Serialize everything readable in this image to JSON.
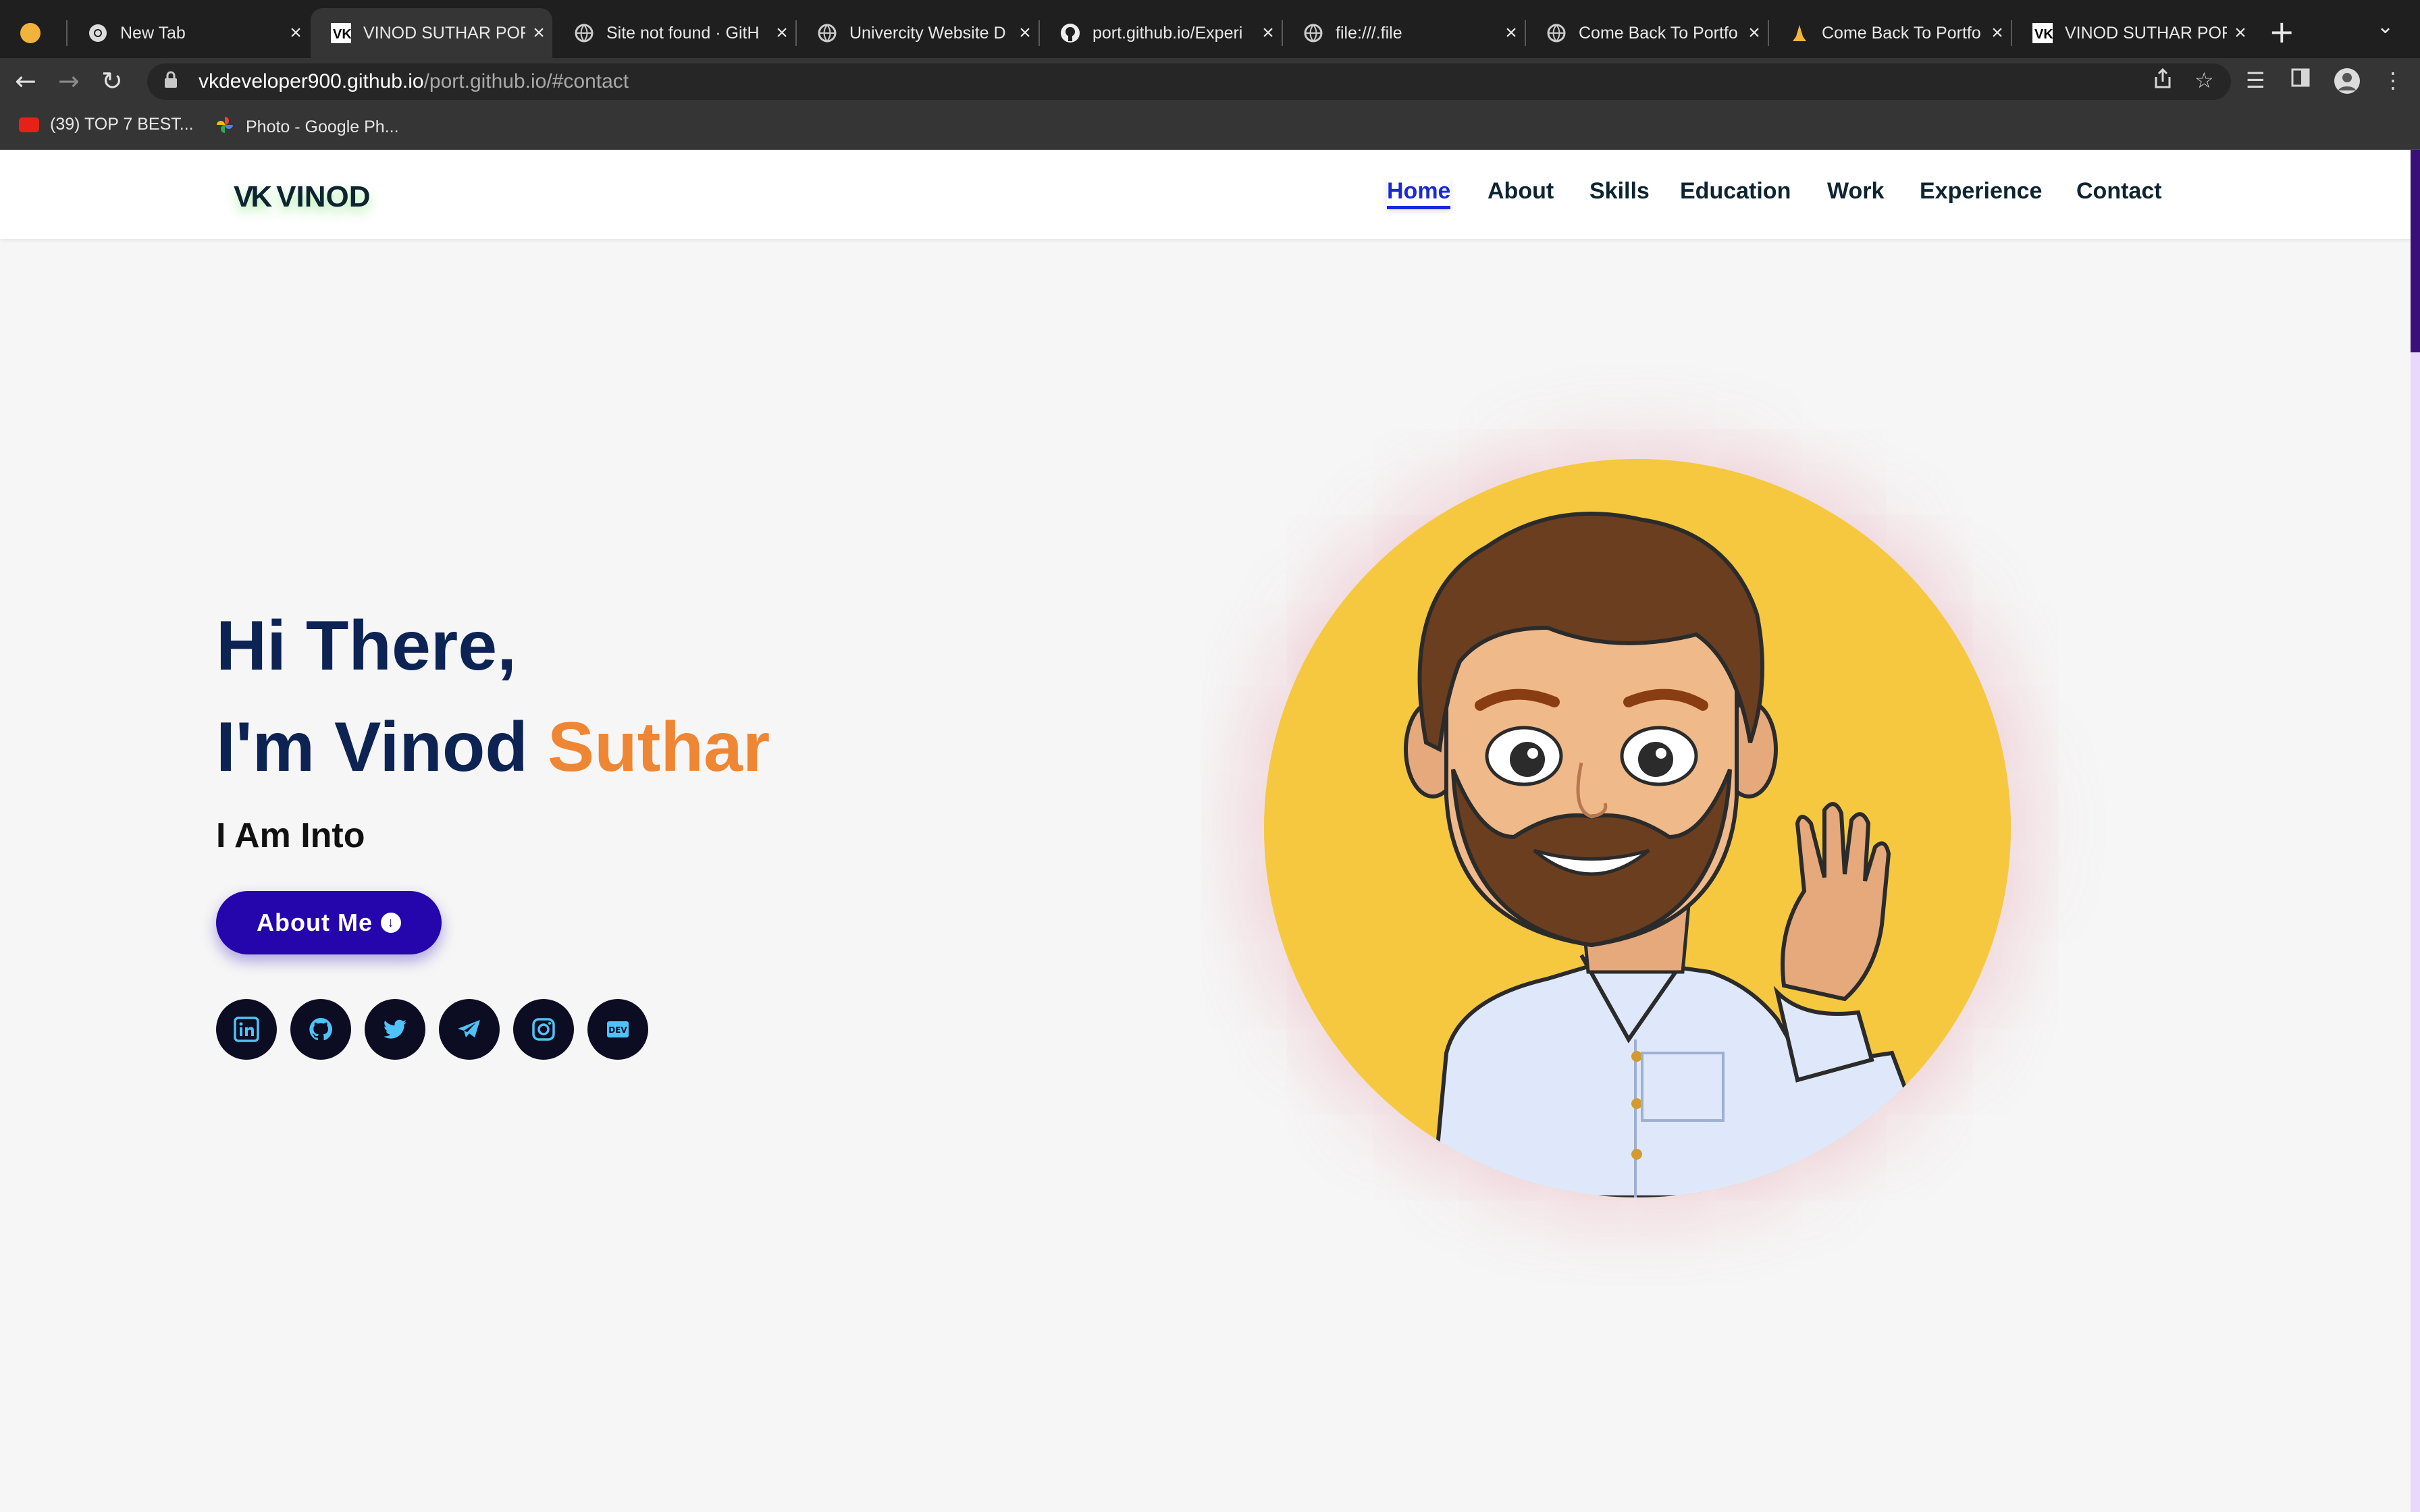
{
  "browser": {
    "tabs": [
      {
        "title": "",
        "icon": "profile-avatar-icon",
        "active": false
      },
      {
        "title": "New Tab",
        "icon": "chrome-icon",
        "active": false
      },
      {
        "title": "VINOD SUTHAR POR",
        "icon": "vk-logo-icon",
        "active": true
      },
      {
        "title": "Site not found · GitH",
        "icon": "globe-icon",
        "active": false
      },
      {
        "title": "Univercity Website D",
        "icon": "globe-icon",
        "active": false
      },
      {
        "title": "port.github.io/Experi",
        "icon": "github-icon",
        "active": false
      },
      {
        "title": "file:///.file",
        "icon": "globe-icon",
        "active": false
      },
      {
        "title": "Come Back To Portfo",
        "icon": "globe-icon",
        "active": false
      },
      {
        "title": "Come Back To Portfo",
        "icon": "praying-hands-icon",
        "active": false
      },
      {
        "title": "VINOD SUTHAR POR",
        "icon": "vk-logo-icon",
        "active": false
      }
    ],
    "url_host": "vkdeveloper900.github.io",
    "url_path": "/port.github.io/#contact",
    "bookmarks": [
      {
        "label": "(39) TOP 7 BEST...",
        "icon": "youtube-icon"
      },
      {
        "label": "Photo - Google Ph...",
        "icon": "google-photos-icon"
      }
    ]
  },
  "site": {
    "logo_mark": "VK",
    "logo_text": "VINOD",
    "nav": [
      {
        "label": "Home",
        "active": true
      },
      {
        "label": "About",
        "active": false
      },
      {
        "label": "Skills",
        "active": false
      },
      {
        "label": "Education",
        "active": false
      },
      {
        "label": "Work",
        "active": false
      },
      {
        "label": "Experience",
        "active": false
      },
      {
        "label": "Contact",
        "active": false
      }
    ],
    "hero": {
      "greeting": "Hi There,",
      "intro_prefix": "I'm Vinod ",
      "intro_accent": "Suthar",
      "subtitle": "I Am Into",
      "button_label": "About Me"
    },
    "socials": [
      {
        "name": "linkedin"
      },
      {
        "name": "github"
      },
      {
        "name": "twitter"
      },
      {
        "name": "telegram"
      },
      {
        "name": "instagram"
      },
      {
        "name": "dev",
        "label": "DEV"
      }
    ]
  },
  "colors": {
    "navy": "#0d2353",
    "accent_orange": "#ef8634",
    "button_blue": "#2506ad",
    "active_link": "#1a2bd6",
    "avatar_bg": "#f6c840",
    "social_icon": "#4fc3f7"
  }
}
